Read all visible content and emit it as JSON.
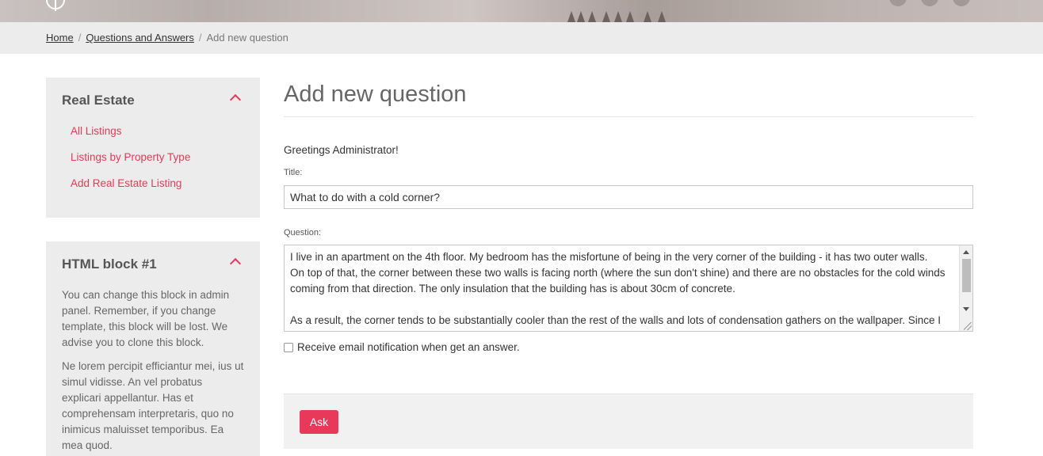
{
  "breadcrumb": {
    "items": [
      "Home",
      "Questions and Answers"
    ],
    "current": "Add new question",
    "separator": "/"
  },
  "sidebar": {
    "real_estate": {
      "title": "Real Estate",
      "links": [
        "All Listings",
        "Listings by Property Type",
        "Add Real Estate Listing"
      ]
    },
    "html_block": {
      "title": "HTML block #1",
      "paragraphs": [
        "You can change this block in admin panel. Remember, if you change template, this block will be lost. We advise you to clone this block.",
        "Ne lorem percipit efficiantur mei, ius ut simul vidisse. An vel probatus explicari appellantur. Has et comprehensam interpretaris, quo no inimicus maluisset temporibus. Ea mea quod."
      ]
    }
  },
  "main": {
    "title": "Add new question",
    "greeting": "Greetings Administrator!",
    "title_label": "Title:",
    "title_value": "What to do with a cold corner?",
    "question_label": "Question:",
    "question_value": "I live in an apartment on the 4th floor. My bedroom has the misfortune of being in the very corner of the building - it has two outer walls.\nOn top of that, the corner between these two walls is facing north (where the sun don't shine) and there are no obstacles for the cold winds\ncoming from that direction. The only insulation that the building has is about 30cm of concrete.\n\nAs a result, the corner tends to be substantially cooler than the rest of the walls and lots of condensation gathers on the wallpaper. Since I",
    "notify_label": "Receive email notification when get an answer.",
    "ask_label": "Ask"
  },
  "colors": {
    "accent": "#e8395a",
    "panel_bg": "#ececec"
  }
}
